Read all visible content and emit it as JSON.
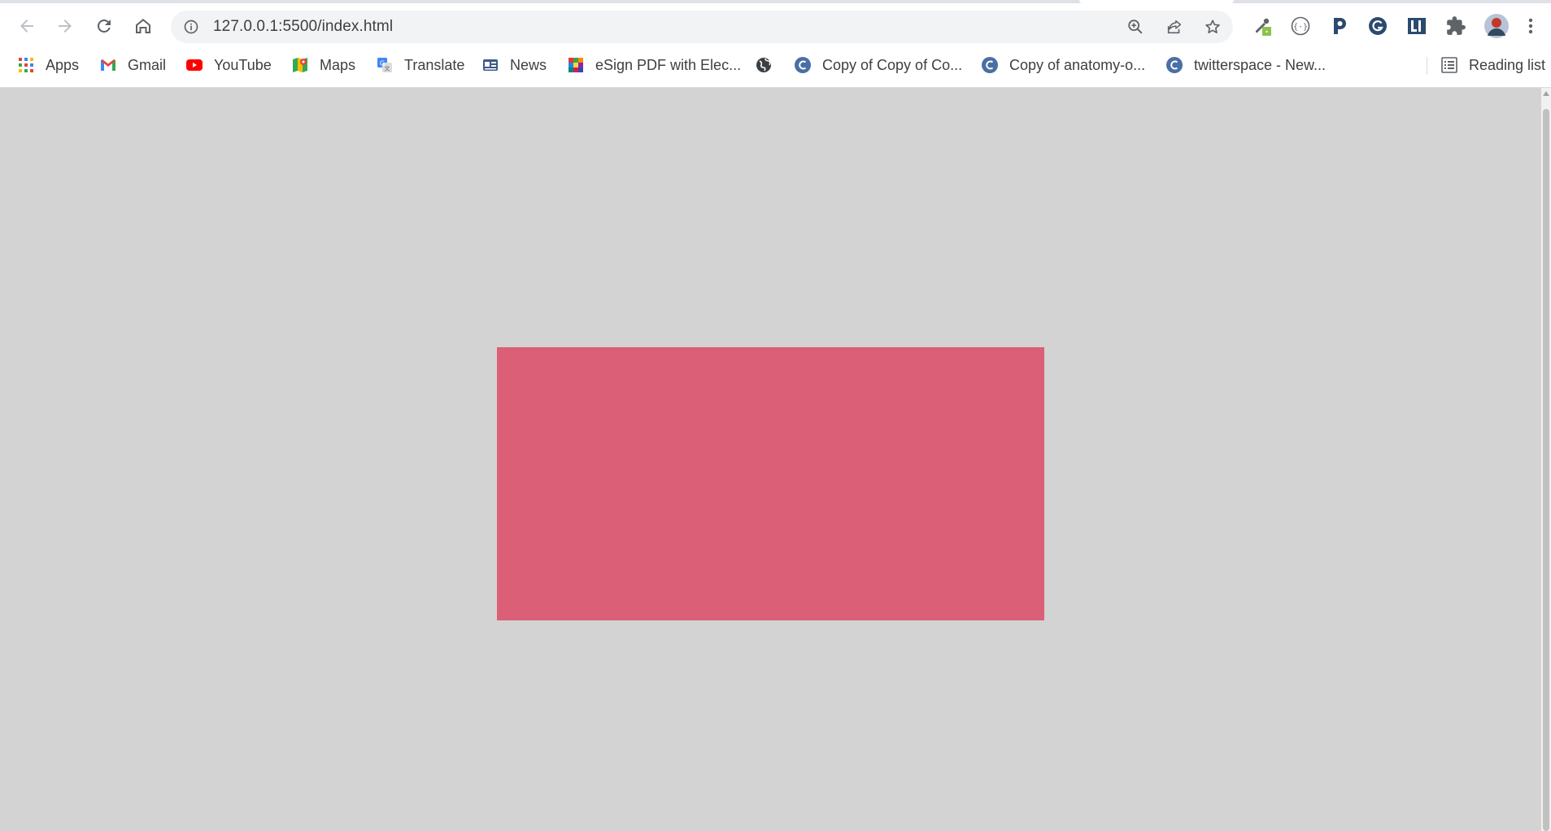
{
  "browser": {
    "address_bar": {
      "url": "127.0.0.1:5500/index.html"
    },
    "bookmarks": [
      {
        "label": "Apps",
        "icon": "apps-grid-icon"
      },
      {
        "label": "Gmail",
        "icon": "gmail-icon"
      },
      {
        "label": "YouTube",
        "icon": "youtube-icon"
      },
      {
        "label": "Maps",
        "icon": "maps-icon"
      },
      {
        "label": "Translate",
        "icon": "translate-icon"
      },
      {
        "label": "News",
        "icon": "news-icon"
      },
      {
        "label": "eSign PDF with Elec...",
        "icon": "esign-icon"
      },
      {
        "label": "",
        "icon": "globe-icon"
      },
      {
        "label": "Copy of Copy of Co...",
        "icon": "c-logo-icon"
      },
      {
        "label": "Copy of anatomy-o...",
        "icon": "c-logo-icon"
      },
      {
        "label": "twitterspace - New...",
        "icon": "c-logo-icon"
      }
    ],
    "reading_list": {
      "label": "Reading list",
      "icon": "reading-list-icon"
    }
  },
  "page": {
    "background_color": "#d3d3d3",
    "box_color": "#db6077"
  },
  "colors": {
    "chrome_icon": "#5f6368",
    "disabled_icon": "#bdc1c6",
    "bookmark_c_logo": "#4a6fa5"
  }
}
